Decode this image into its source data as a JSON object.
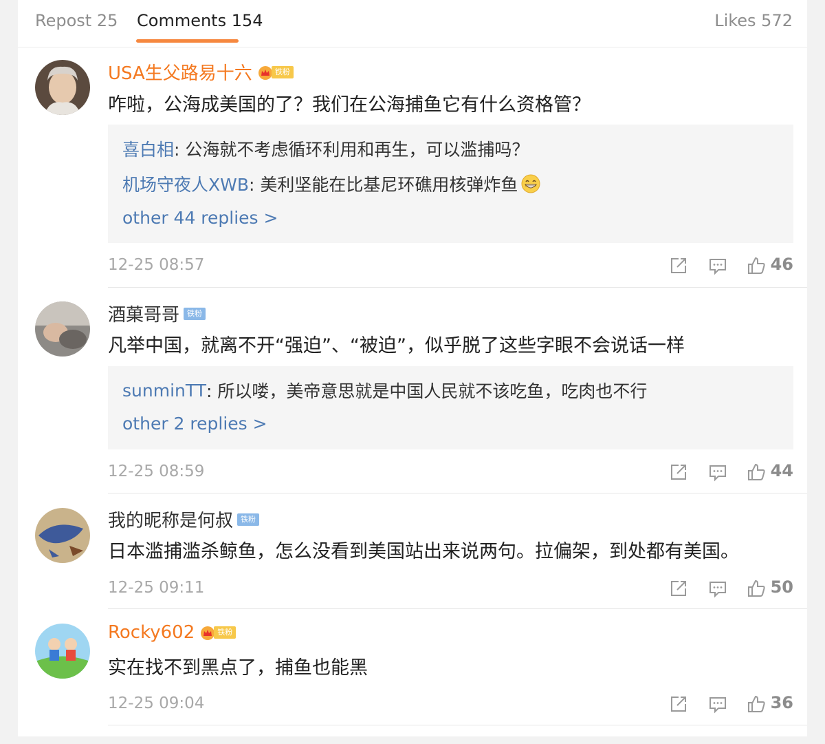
{
  "tabs": {
    "repost": "Repost 25",
    "comments": "Comments 154",
    "likes": "Likes 572"
  },
  "colors": {
    "accent": "#f6883f",
    "username_link": "#4d7ab3",
    "orange_name": "#f47920"
  },
  "comments": [
    {
      "user": "USA生父路易十六",
      "badge": "铁粉",
      "badge_icon": "crown-icon",
      "text": "咋啦，公海成美国的了？我们在公海捕鱼它有什么资格管？",
      "replies": [
        {
          "user": "喜白相",
          "text": ": 公海就不考虑循环利用和再生，可以滥捕吗？"
        },
        {
          "user": "机场守夜人XWB",
          "text": ": 美利坚能在比基尼环礁用核弹炸鱼"
        }
      ],
      "more": "other 44 replies >",
      "time": "12-25 08:57",
      "likes": "46"
    },
    {
      "user": "酒菓哥哥",
      "badge": "铁粉",
      "text": "凡举中国，就离不开“强迫”、“被迫”，似乎脱了这些字眼不会说话一样",
      "replies": [
        {
          "user": "sunminTT",
          "text": ": 所以喽，美帝意思就是中国人民就不该吃鱼，吃肉也不行"
        }
      ],
      "more": "other 2 replies >",
      "time": "12-25 08:59",
      "likes": "44"
    },
    {
      "user": "我的昵称是何叔",
      "badge": "铁粉",
      "text": "日本滥捕滥杀鲸鱼，怎么没看到美国站出来说两句。拉偏架，到处都有美国。",
      "time": "12-25 09:11",
      "likes": "50"
    },
    {
      "user": "Rocky602",
      "badge": "铁粉",
      "badge_icon": "crown-icon",
      "text": "实在找不到黑点了，捕鱼也能黑",
      "time": "12-25 09:04",
      "likes": "36"
    }
  ]
}
